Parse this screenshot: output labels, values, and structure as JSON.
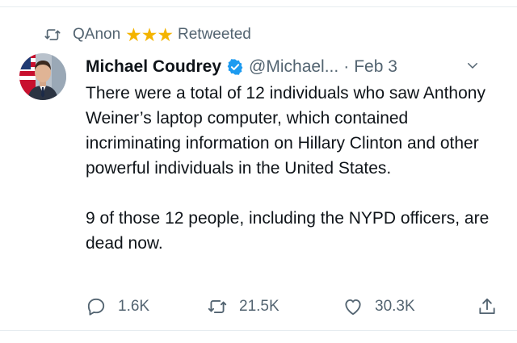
{
  "retweet_banner": {
    "account": "QAnon",
    "stars": "★★★",
    "label": "Retweeted",
    "icon": "retweet-icon"
  },
  "author": {
    "display_name": "Michael Coudrey",
    "verified": true,
    "handle": "@Michael...",
    "separator": "·",
    "date": "Feb 3"
  },
  "tweet_text": {
    "paragraph_1": "There were a total of 12 individuals who saw Anthony Weiner’s laptop computer, which contained incriminating information on Hillary Clinton and other powerful individuals in the United States.",
    "paragraph_2": "9 of those 12 people, including the NYPD officers, are dead now."
  },
  "actions": {
    "replies": "1.6K",
    "retweets": "21.5K",
    "likes": "30.3K"
  },
  "colors": {
    "verified_blue": "#1d9bf0",
    "star_gold": "#f4b400",
    "secondary_text": "#536471",
    "primary_text": "#0f1419"
  }
}
